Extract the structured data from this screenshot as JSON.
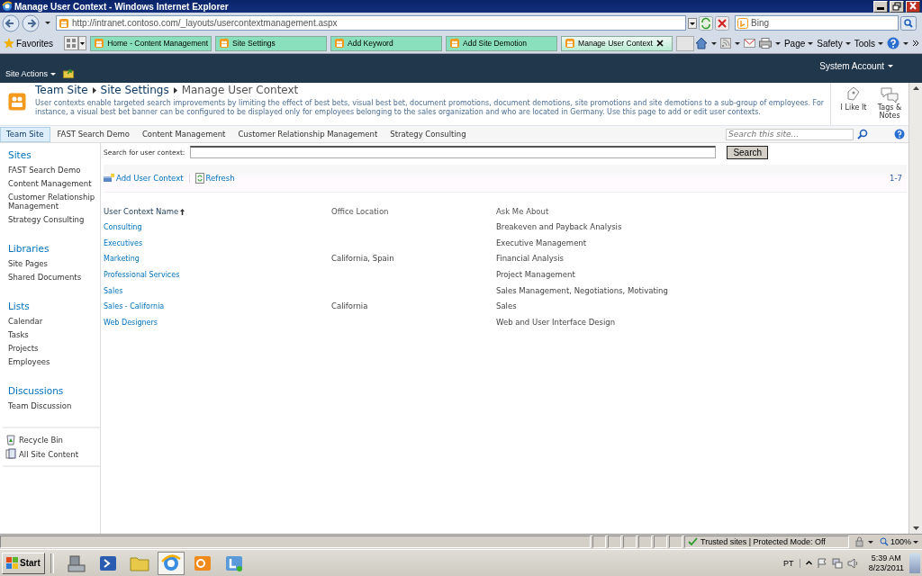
{
  "window": {
    "title": "Manage User Context - Windows Internet Explorer"
  },
  "address_bar": {
    "url": "http://intranet.contoso.com/_layouts/usercontextmanagement.aspx"
  },
  "search_box": {
    "value": "Bing"
  },
  "favorites": {
    "label": "Favorites"
  },
  "tabs": [
    {
      "label": "Home - Content Management",
      "selected": false
    },
    {
      "label": "Site Settings",
      "selected": false
    },
    {
      "label": "Add Keyword",
      "selected": false
    },
    {
      "label": "Add Site Demotion",
      "selected": false
    },
    {
      "label": "Manage User Context",
      "selected": true
    }
  ],
  "command_bar": [
    "Page",
    "Safety",
    "Tools"
  ],
  "ribbon": {
    "site_actions": "Site Actions",
    "user": "System Account"
  },
  "title_area": {
    "breadcrumb": [
      "Team Site",
      "Site Settings",
      "Manage User Context"
    ],
    "description": "User contexts enable targeted search improvements by limiting the effect of best bets, visual best bet, document promotions, document demotions, site promotions and site demotions to a sub-group of employees. For instance, a visual best bet banner can be configured to be displayed only for employees belonging to the sales organization and who are located in Germany. Use this page to add or edit user contexts.",
    "actions": [
      "I Like It",
      "Tags & Notes"
    ]
  },
  "top_nav": {
    "items": [
      {
        "label": "Team Site",
        "selected": true
      },
      {
        "label": "FAST Search Demo",
        "selected": false
      },
      {
        "label": "Content Management",
        "selected": false
      },
      {
        "label": "Customer Relationship Management",
        "selected": false
      },
      {
        "label": "Strategy Consulting",
        "selected": false
      }
    ],
    "search_placeholder": "Search this site..."
  },
  "left_nav": {
    "sections": [
      {
        "heading": "Sites",
        "items": [
          "FAST Search Demo",
          "Content Management",
          "Customer Relationship Management",
          "Strategy Consulting"
        ]
      },
      {
        "heading": "Libraries",
        "items": [
          "Site Pages",
          "Shared Documents"
        ]
      },
      {
        "heading": "Lists",
        "items": [
          "Calendar",
          "Tasks",
          "Projects",
          "Employees"
        ]
      },
      {
        "heading": "Discussions",
        "items": [
          "Team Discussion"
        ]
      }
    ],
    "footer": [
      "Recycle Bin",
      "All Site Content"
    ]
  },
  "search": {
    "label": "Search for user context:",
    "button": "Search"
  },
  "toolbar": {
    "actions": [
      "Add User Context",
      "Refresh"
    ],
    "paging": "1-7"
  },
  "table": {
    "columns": [
      {
        "label": "User Context Name",
        "sorted": true
      },
      {
        "label": "Office Location",
        "sorted": false
      },
      {
        "label": "Ask Me About",
        "sorted": false
      }
    ],
    "rows": [
      {
        "name": "Consulting",
        "ask_me_about": "Breakeven and Payback Analysis"
      },
      {
        "name": "Executives",
        "ask_me_about": "Executive Management"
      },
      {
        "name": "Marketing",
        "office_location": "California, Spain",
        "ask_me_about": "Financial Analysis"
      },
      {
        "name": "Professional Services",
        "ask_me_about": "Project Management"
      },
      {
        "name": "Sales",
        "ask_me_about": "Sales Management, Negotiations, Motivating"
      },
      {
        "name": "Sales - California",
        "office_location": "California",
        "ask_me_about": "Sales"
      },
      {
        "name": "Web Designers",
        "ask_me_about": "Web and User Interface Design"
      }
    ]
  },
  "status_bar": {
    "zone": "Trusted sites | Protected Mode: Off",
    "zoom": "100%"
  },
  "taskbar": {
    "start": "Start",
    "language": "PT",
    "time": "5:39 AM",
    "date": "8/23/2011"
  }
}
